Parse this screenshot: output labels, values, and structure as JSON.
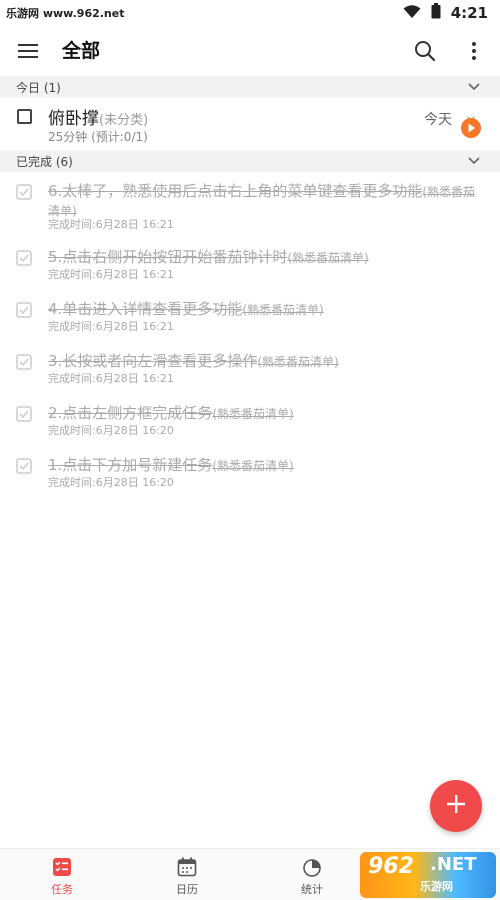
{
  "status_bar": {
    "source_text": "乐游网 www.962.net",
    "time": "4:21",
    "icons": [
      "wifi-icon",
      "battery-icon"
    ]
  },
  "app_bar": {
    "title": "全部",
    "icons": [
      "menu-icon",
      "search-icon",
      "more-vert-icon"
    ]
  },
  "today_section": {
    "header": "今日 (1)",
    "tasks": [
      {
        "title": "俯卧撑",
        "category": "(未分类)",
        "subtitle": "25分钟 (预计:0/1)",
        "due": "今天",
        "icon": "tomato-timer-icon"
      }
    ]
  },
  "done_section": {
    "header": "已完成 (6)",
    "tasks": [
      {
        "title": "6.太棒了，熟悉使用后点击右上角的菜单键查看更多功能",
        "category": "(熟悉番茄清单)",
        "time": "完成时间:6月28日 16:21"
      },
      {
        "title": "5.点击右侧开始按钮开始番茄钟计时",
        "category": "(熟悉番茄清单)",
        "time": "完成时间:6月28日 16:21"
      },
      {
        "title": "4.单击进入详情查看更多功能",
        "category": "(熟悉番茄清单)",
        "time": "完成时间:6月28日 16:21"
      },
      {
        "title": "3.长按或者向左滑查看更多操作",
        "category": "(熟悉番茄清单)",
        "time": "完成时间:6月28日 16:21"
      },
      {
        "title": "2.点击左侧方框完成任务",
        "category": "(熟悉番茄清单)",
        "time": "完成时间:6月28日 16:20"
      },
      {
        "title": "1.点击下方加号新建任务",
        "category": "(熟悉番茄清单)",
        "time": "完成时间:6月28日 16:20"
      }
    ]
  },
  "fab": {
    "icon": "plus-icon"
  },
  "bottom_nav": {
    "items": [
      {
        "label": "任务",
        "icon": "task-list-icon",
        "active": true
      },
      {
        "label": "日历",
        "icon": "calendar-icon",
        "active": false
      },
      {
        "label": "统计",
        "icon": "pie-chart-icon",
        "active": false
      }
    ]
  },
  "watermark": {
    "number": "962",
    "suffix": ".NET",
    "site": "乐游网"
  },
  "colors": {
    "accent": "#f04a4a",
    "section_bg": "#f2f2f2",
    "done_text": "#aaaaaa"
  }
}
